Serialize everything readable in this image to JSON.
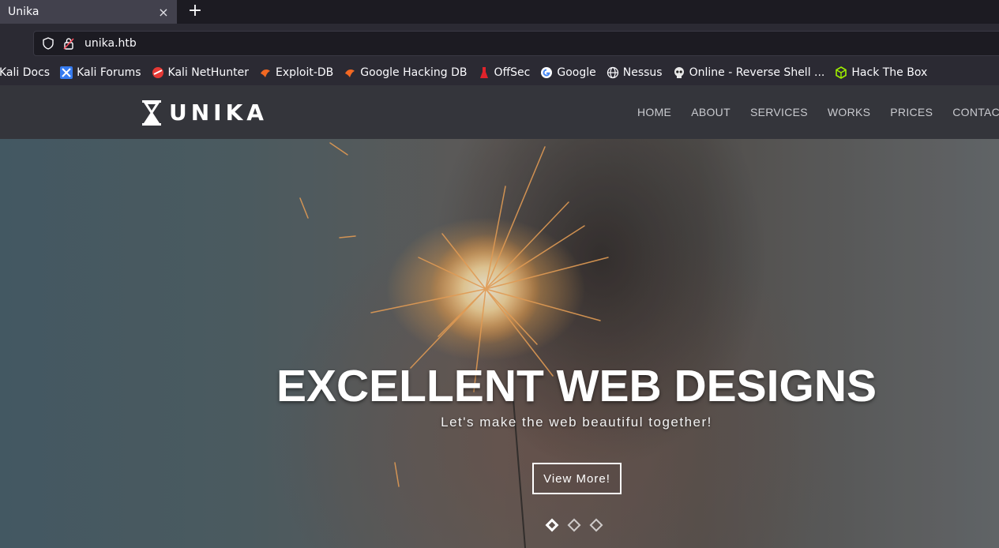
{
  "browser": {
    "tab_title": "Unika",
    "tab_close": "×",
    "new_tab": "+",
    "url": "unika.htb",
    "bookmarks": [
      {
        "label": "Kali Docs",
        "icon": "kali-icon"
      },
      {
        "label": "Kali Forums",
        "icon": "kali-forums-icon"
      },
      {
        "label": "Kali NetHunter",
        "icon": "nethunter-icon"
      },
      {
        "label": "Exploit-DB",
        "icon": "exploit-db-icon"
      },
      {
        "label": "Google Hacking DB",
        "icon": "ghdb-icon"
      },
      {
        "label": "OffSec",
        "icon": "offsec-icon"
      },
      {
        "label": "Google",
        "icon": "google-icon"
      },
      {
        "label": "Nessus",
        "icon": "globe-icon"
      },
      {
        "label": "Online - Reverse Shell ...",
        "icon": "skull-icon"
      },
      {
        "label": "Hack The Box",
        "icon": "htb-cube-icon"
      }
    ]
  },
  "site": {
    "logo_text": "UNIKA",
    "nav": [
      "HOME",
      "ABOUT",
      "SERVICES",
      "WORKS",
      "PRICES",
      "CONTACT"
    ],
    "hero": {
      "title": "EXCELLENT WEB DESIGNS",
      "subtitle": "Let's make the web beautiful together!",
      "button": "View More!",
      "slide_count": 3,
      "active_slide": 1
    }
  }
}
